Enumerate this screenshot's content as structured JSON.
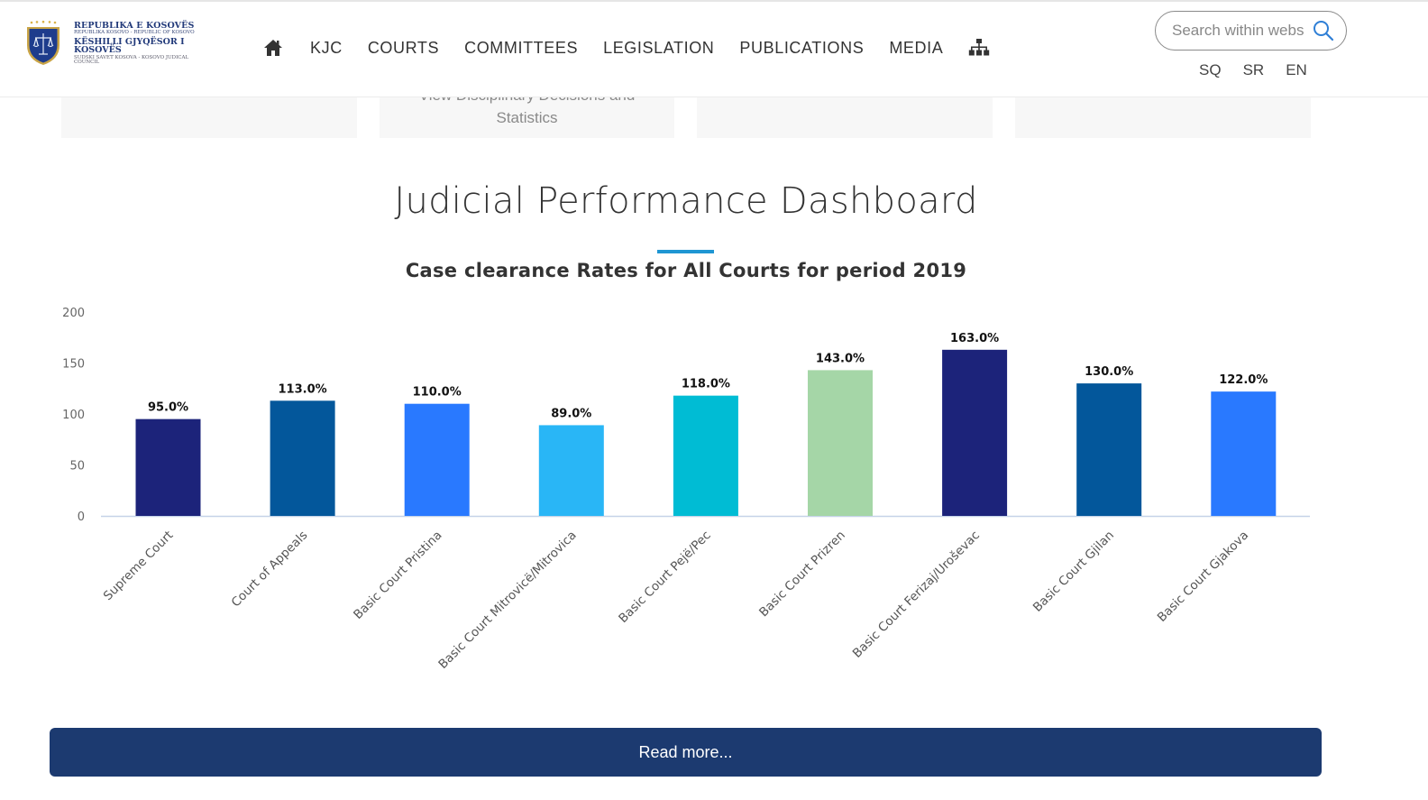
{
  "header": {
    "logo": {
      "line1": "REPUBLIKA E KOSOVËS",
      "line2": "REPUBLIKA KOSOVO - REPUBLIC OF KOSOVO",
      "line3": "KËSHILLI GJYQËSOR I KOSOVËS",
      "line4": "SUDSKI SAVET KOSOVA - KOSOVO JUDICAL COUNCIL"
    },
    "nav": {
      "home_icon": "home-icon",
      "items": [
        "KJC",
        "COURTS",
        "COMMITTEES",
        "LEGISLATION",
        "PUBLICATIONS",
        "MEDIA"
      ],
      "sitemap_icon": "sitemap-icon"
    },
    "search": {
      "placeholder": "Search within webs",
      "value": "",
      "icon": "search-icon"
    },
    "languages": [
      "SQ",
      "SR",
      "EN"
    ]
  },
  "cards": [
    {
      "text_line1": "",
      "text_line2": ""
    },
    {
      "text_line1": "View Disciplinary Decisions and",
      "text_line2": "Statistics"
    },
    {
      "text_line1": "",
      "text_line2": ""
    },
    {
      "text_line1": "",
      "text_line2": ""
    }
  ],
  "section": {
    "title": "Judicial Performance Dashboard",
    "subtitle": "Case clearance Rates for All Courts for period 2019",
    "accent_color": "#1f96d3"
  },
  "chart_data": {
    "type": "bar",
    "title": "Case clearance Rates for All Courts for period 2019",
    "xlabel": "",
    "ylabel": "",
    "ylim": [
      0,
      200
    ],
    "yticks": [
      0,
      50,
      100,
      150,
      200
    ],
    "grid": false,
    "legend": "none",
    "categories": [
      "Supreme Court",
      "Court of Appeals",
      "Basic Court Pristina",
      "Basic Court Mitrovicë/Mitrovica",
      "Basic Court Pejë/Pec",
      "Basic Court Prizren",
      "Basic Court Ferizaj/Uroševac",
      "Basic Court Gjilan",
      "Basic Court Gjakova"
    ],
    "values": [
      95,
      113,
      110,
      89,
      118,
      143,
      163,
      130,
      122
    ],
    "data_labels": [
      "95.0%",
      "113.0%",
      "110.0%",
      "89.0%",
      "118.0%",
      "143.0%",
      "163.0%",
      "130.0%",
      "122.0%"
    ],
    "colors": [
      "#1c237a",
      "#03579b",
      "#2979ff",
      "#29b6f6",
      "#00bcd4",
      "#a5d6a7",
      "#1c237a",
      "#03579b",
      "#2979ff"
    ]
  },
  "read_more": {
    "label": "Read more..."
  },
  "colors": {
    "button_bg": "#1c3a70",
    "axis_line": "#c5d3e8"
  }
}
